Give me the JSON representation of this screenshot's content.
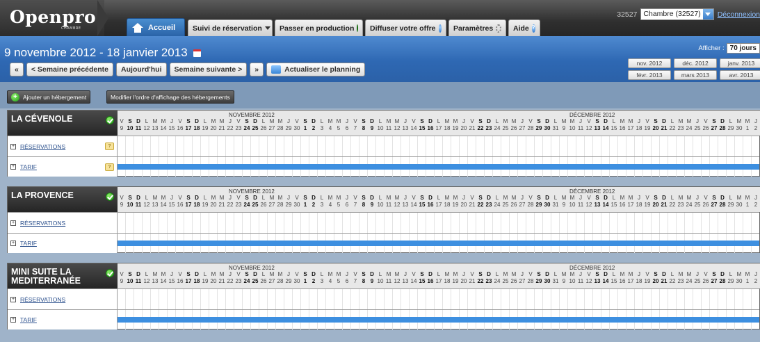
{
  "topbar": {
    "logo": "Openpro",
    "logo_sub": "CHAMBRE",
    "tabs": {
      "accueil": "Accueil",
      "suivi": "Suivi de réservation",
      "production": "Passer en production",
      "diffuser": "Diffuser votre offre",
      "parametres": "Paramètres",
      "aide": "Aide"
    },
    "account_id": "32527",
    "account_select": "Chambre (32527)",
    "logout": "Déconnexion"
  },
  "header": {
    "date_range": "9 novembre 2012 - 18 janvier 2013",
    "first": "«",
    "prev": "< Semaine précédente",
    "today": "Aujourd'hui",
    "next": "Semaine suivante >",
    "last": "»",
    "refresh": "Actualiser le planning",
    "afficher_label": "Afficher :",
    "afficher_value": "70 jours",
    "months": [
      "nov. 2012",
      "déc. 2012",
      "janv. 2013",
      "févr. 2013",
      "mars 2013",
      "avr. 2013"
    ]
  },
  "actions": {
    "add": "Ajouter un hébergement",
    "reorder": "Modifier l'ordre d'affichage des hébergements"
  },
  "calendar": {
    "month1": "NOVEMBRE 2012",
    "month2": "DÉCEMBRE 2012",
    "letters": [
      "V",
      "S",
      "D",
      "L",
      "M",
      "M",
      "J",
      "V",
      "S",
      "D",
      "L",
      "M",
      "M",
      "J",
      "V",
      "S",
      "D",
      "L",
      "M",
      "M",
      "J",
      "V",
      "S",
      "D",
      "L",
      "M",
      "M",
      "J",
      "V",
      "S",
      "D",
      "L",
      "M",
      "M",
      "J",
      "V",
      "S",
      "D",
      "L",
      "M",
      "M",
      "J",
      "V",
      "S",
      "D",
      "L",
      "M",
      "M",
      "J",
      "V",
      "S",
      "D",
      "L",
      "M",
      "M",
      "J",
      "V",
      "S",
      "D",
      "L",
      "M",
      "M",
      "J",
      "V",
      "S",
      "D",
      "L",
      "M",
      "M",
      "J",
      "V",
      "S",
      "D",
      "L",
      "M",
      "M",
      "J",
      "V",
      "S"
    ],
    "numbers": [
      "9",
      "10",
      "11",
      "12",
      "13",
      "14",
      "15",
      "16",
      "17",
      "18",
      "19",
      "20",
      "21",
      "22",
      "23",
      "24",
      "25",
      "26",
      "27",
      "28",
      "29",
      "30",
      "1",
      "2",
      "3",
      "4",
      "5",
      "6",
      "7",
      "8",
      "9",
      "10",
      "11",
      "12",
      "13",
      "14",
      "15",
      "16",
      "17",
      "18",
      "19",
      "20",
      "21",
      "22",
      "23",
      "24",
      "25",
      "26",
      "27",
      "28",
      "29",
      "30",
      "31"
    ]
  },
  "units": [
    {
      "name": "LA CÉVENOLE",
      "reservations": "RÉSERVATIONS",
      "tarif": "TARIF",
      "has_q": true
    },
    {
      "name": "LA PROVENCE",
      "reservations": "RÉSERVATIONS",
      "tarif": "TARIF",
      "has_q": false
    },
    {
      "name": "MINI SUITE LA MEDITERRANÉE",
      "reservations": "RÉSERVATIONS",
      "tarif": "TARIF",
      "has_q": false
    }
  ],
  "colors": {
    "accent": "#2e68b3",
    "tarif_bar": "#3d8fe0",
    "ok": "#1e9a16"
  }
}
